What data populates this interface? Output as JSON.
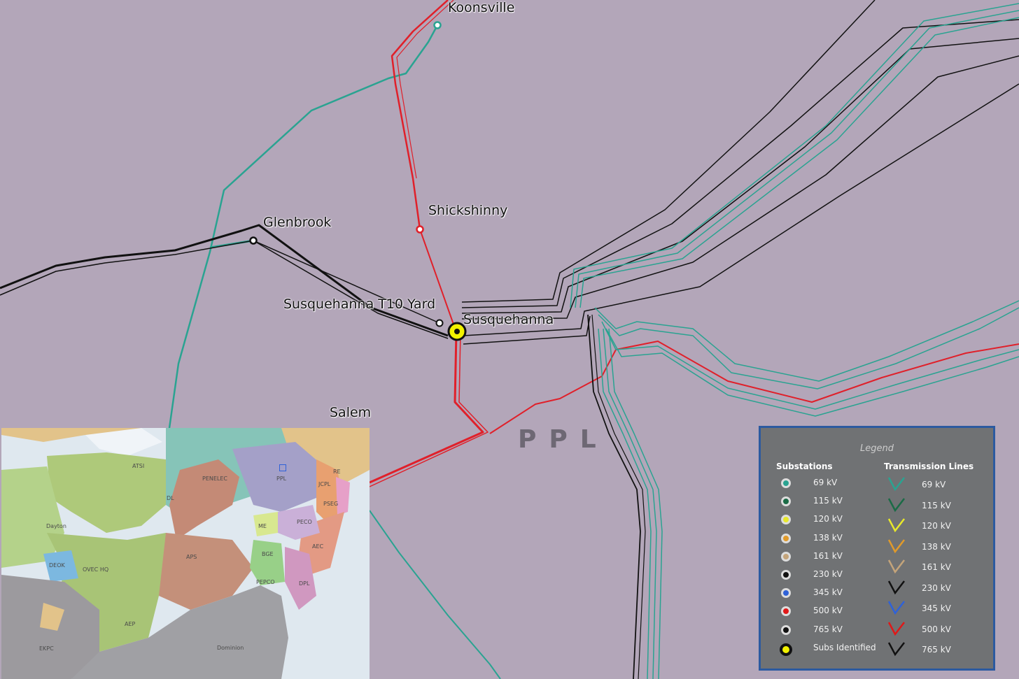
{
  "stations": [
    {
      "id": "koonsville",
      "name": "Koonsville"
    },
    {
      "id": "shickshinny",
      "name": "Shickshinny"
    },
    {
      "id": "glenbrook",
      "name": "Glenbrook"
    },
    {
      "id": "susq-t10",
      "name": "Susquehanna T10 Yard"
    },
    {
      "id": "susquehanna",
      "name": "Susquehanna"
    },
    {
      "id": "salem",
      "name": "Salem"
    }
  ],
  "region_label": "PPL",
  "inset": {
    "regions": [
      "ATSI",
      "PENELEC",
      "PPL",
      "JCPL",
      "PSEG",
      "RE",
      "DL",
      "PECO",
      "ME",
      "AEC",
      "Dayton",
      "AEP",
      "BGE",
      "DPL",
      "PEPCO",
      "APS",
      "DEOK",
      "OVEC HQ",
      "EKPC",
      "Dominion"
    ]
  },
  "legend": {
    "title": "Legend",
    "substations_heading": "Substations",
    "lines_heading": "Transmission Lines",
    "substations": [
      {
        "label": "69 kV",
        "color": "#2aa391"
      },
      {
        "label": "115 kV",
        "color": "#1a6b46"
      },
      {
        "label": "120 kV",
        "color": "#e8e82a"
      },
      {
        "label": "138 kV",
        "color": "#e09a2a"
      },
      {
        "label": "161 kV",
        "color": "#c4a47a"
      },
      {
        "label": "230 kV",
        "color": "#111111"
      },
      {
        "label": "345 kV",
        "color": "#2f62d8"
      },
      {
        "label": "500 kV",
        "color": "#e01818"
      },
      {
        "label": "765 kV",
        "color": "#111111"
      },
      {
        "label": "Subs Identified",
        "color": "#f2f200"
      }
    ],
    "lines": [
      {
        "label": "69 kV",
        "color": "#2aa391"
      },
      {
        "label": "115 kV",
        "color": "#1a6b46"
      },
      {
        "label": "120 kV",
        "color": "#e8e82a"
      },
      {
        "label": "138 kV",
        "color": "#e09a2a"
      },
      {
        "label": "161 kV",
        "color": "#c4a47a"
      },
      {
        "label": "230 kV",
        "color": "#111111"
      },
      {
        "label": "345 kV",
        "color": "#2f62d8"
      },
      {
        "label": "500 kV",
        "color": "#e01818"
      },
      {
        "label": "765 kV",
        "color": "#111111"
      }
    ]
  }
}
